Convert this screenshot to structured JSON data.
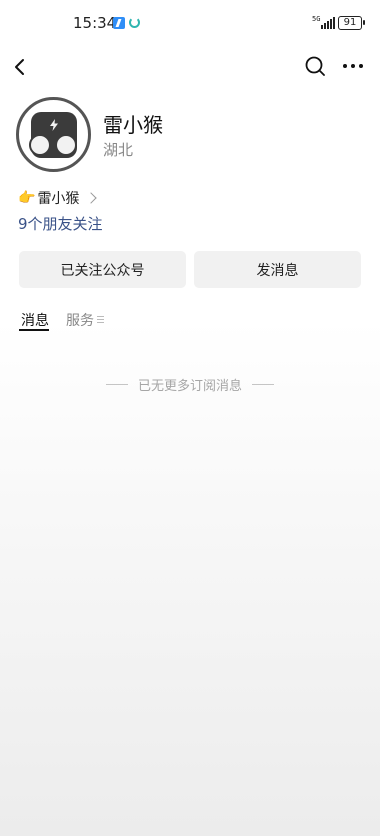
{
  "status_bar": {
    "time": "15:34",
    "network": "5G",
    "battery": "91"
  },
  "nav": {
    "back_icon": "chevron-left-icon",
    "search_icon": "search-icon",
    "more_icon": "more-horizontal-icon"
  },
  "profile": {
    "name": "雷小猴",
    "region": "湖北",
    "mention_emoji": "👉",
    "mention_name": "雷小猴",
    "friends_following": "9个朋友关注"
  },
  "actions": {
    "follow_label": "已关注公众号",
    "message_label": "发消息"
  },
  "tabs": [
    {
      "label": "消息",
      "active": true
    },
    {
      "label": "服务",
      "active": false
    }
  ],
  "end_note": "已无更多订阅消息",
  "colors": {
    "link": "#3a5288",
    "button_bg": "#f1f1f1",
    "muted": "#888888"
  }
}
